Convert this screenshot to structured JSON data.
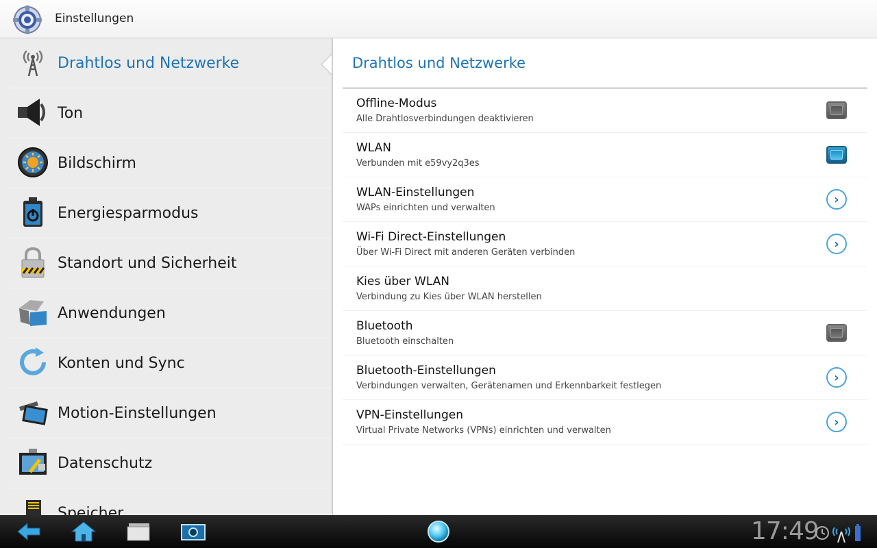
{
  "app": {
    "title": "Einstellungen"
  },
  "sidebar": {
    "items": [
      {
        "label": "Drahtlos und Netzwerke",
        "icon": "antenna-icon",
        "active": true
      },
      {
        "label": "Ton",
        "icon": "speaker-icon"
      },
      {
        "label": "Bildschirm",
        "icon": "brightness-icon"
      },
      {
        "label": "Energiesparmodus",
        "icon": "power-saving-icon"
      },
      {
        "label": "Standort und Sicherheit",
        "icon": "padlock-icon"
      },
      {
        "label": "Anwendungen",
        "icon": "applications-icon"
      },
      {
        "label": "Konten und Sync",
        "icon": "sync-icon"
      },
      {
        "label": "Motion-Einstellungen",
        "icon": "motion-icon"
      },
      {
        "label": "Datenschutz",
        "icon": "privacy-icon"
      },
      {
        "label": "Speicher",
        "icon": "storage-icon"
      }
    ]
  },
  "content": {
    "title": "Drahtlos und Netzwerke",
    "settings": [
      {
        "title": "Offline-Modus",
        "subtitle": "Alle Drahtlosverbindungen deaktivieren",
        "control": "checkbox",
        "checked": false
      },
      {
        "title": "WLAN",
        "subtitle": "Verbunden mit e59vy2q3es",
        "control": "checkbox",
        "checked": true
      },
      {
        "title": "WLAN-Einstellungen",
        "subtitle": "WAPs einrichten und verwalten",
        "control": "chevron"
      },
      {
        "title": "Wi-Fi Direct-Einstellungen",
        "subtitle": "Über Wi-Fi Direct mit anderen Geräten verbinden",
        "control": "chevron"
      },
      {
        "title": "Kies über WLAN",
        "subtitle": "Verbindung zu Kies über WLAN herstellen",
        "control": "none"
      },
      {
        "title": "Bluetooth",
        "subtitle": "Bluetooth einschalten",
        "control": "checkbox",
        "checked": false
      },
      {
        "title": "Bluetooth-Einstellungen",
        "subtitle": "Verbindungen verwalten, Gerätenamen und Erkennbarkeit festlegen",
        "control": "chevron"
      },
      {
        "title": "VPN-Einstellungen",
        "subtitle": "Virtual Private Networks (VPNs) einrichten und verwalten",
        "control": "chevron"
      }
    ],
    "chevron_glyph": "›"
  },
  "statusbar": {
    "time": "17:49",
    "icons": [
      "alarm-icon",
      "wifi-signal-icon",
      "battery-icon"
    ]
  },
  "navbar": {
    "buttons": [
      "back-icon",
      "home-icon",
      "recent-apps-icon",
      "screenshot-icon"
    ]
  },
  "colors": {
    "accent": "#1e73b7",
    "sidebar_bg": "#ececec",
    "bar_bg": "#111111"
  }
}
